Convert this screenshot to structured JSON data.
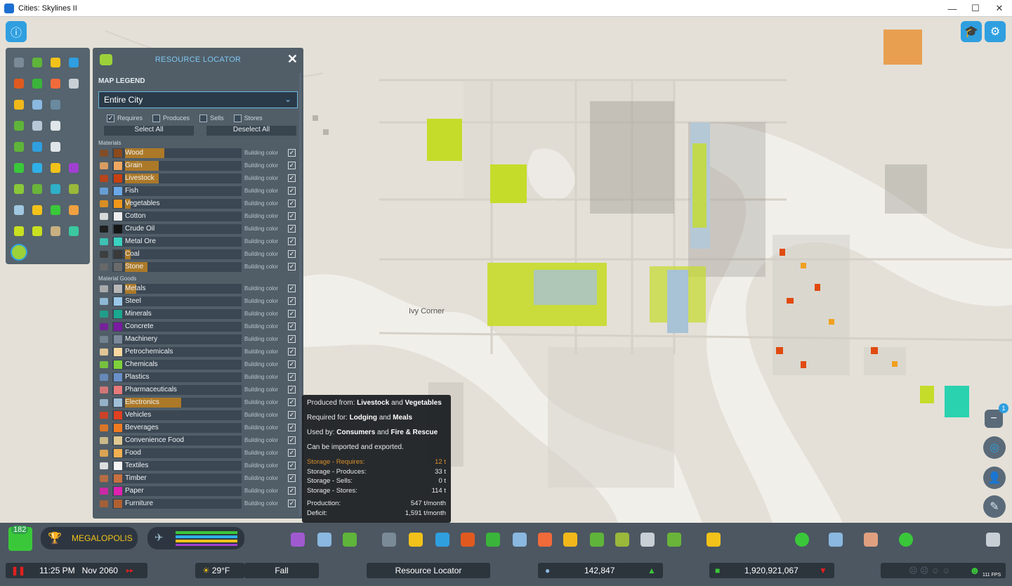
{
  "window": {
    "title": "Cities: Skylines II",
    "minimize": "—",
    "maximize": "☐",
    "close": "✕"
  },
  "map": {
    "district_label": "Ivy Corner"
  },
  "panel": {
    "title": "RESOURCE LOCATOR",
    "close": "✕",
    "legend_label": "MAP LEGEND",
    "scope": "Entire City",
    "filters": [
      {
        "label": "Requires",
        "checked": true
      },
      {
        "label": "Produces",
        "checked": false
      },
      {
        "label": "Sells",
        "checked": false
      },
      {
        "label": "Stores",
        "checked": false
      }
    ],
    "select_all": "Select All",
    "deselect_all": "Deselect All",
    "materials_label": "Materials",
    "materials": [
      {
        "name": "Wood",
        "color": "#8b4a1c",
        "mode": "Building color",
        "hl": 0.35
      },
      {
        "name": "Grain",
        "color": "#f0a860",
        "mode": "Building color",
        "hl": 0.3
      },
      {
        "name": "Livestock",
        "color": "#c9400f",
        "mode": "Building color",
        "hl": 0.3
      },
      {
        "name": "Fish",
        "color": "#6aa8e8",
        "mode": "Building color",
        "hl": 0
      },
      {
        "name": "Vegetables",
        "color": "#f0961a",
        "mode": "Building color",
        "hl": 0.05
      },
      {
        "name": "Cotton",
        "color": "#eeeeee",
        "mode": "Building color",
        "hl": 0
      },
      {
        "name": "Crude Oil",
        "color": "#151515",
        "mode": "Building color",
        "hl": 0
      },
      {
        "name": "Metal Ore",
        "color": "#3ad2c0",
        "mode": "Building color",
        "hl": 0
      },
      {
        "name": "Coal",
        "color": "#3a3a3a",
        "mode": "Building color",
        "hl": 0.05
      },
      {
        "name": "Stone",
        "color": "#6a6a6a",
        "mode": "Building color",
        "hl": 0.2
      }
    ],
    "goods_label": "Material Goods",
    "goods": [
      {
        "name": "Metals",
        "color": "#b7b7b7",
        "mode": "Building color",
        "hl": 0.1
      },
      {
        "name": "Steel",
        "color": "#9ac8e8",
        "mode": "Building color",
        "hl": 0
      },
      {
        "name": "Minerals",
        "color": "#1aa890",
        "mode": "Building color",
        "hl": 0
      },
      {
        "name": "Concrete",
        "color": "#7a1aa0",
        "mode": "Building color",
        "hl": 0
      },
      {
        "name": "Machinery",
        "color": "#7a8a9a",
        "mode": "Building color",
        "hl": 0
      },
      {
        "name": "Petrochemicals",
        "color": "#f8d7a0",
        "mode": "Building color",
        "hl": 0
      },
      {
        "name": "Chemicals",
        "color": "#7ed23a",
        "mode": "Building color",
        "hl": 0
      },
      {
        "name": "Plastics",
        "color": "#6a90c8",
        "mode": "Building color",
        "hl": 0
      },
      {
        "name": "Pharmaceuticals",
        "color": "#e87a7a",
        "mode": "Building color",
        "hl": 0
      },
      {
        "name": "Electronics",
        "color": "#a0c0d8",
        "mode": "Building color",
        "hl": 0.5
      },
      {
        "name": "Vehicles",
        "color": "#e04020",
        "mode": "Building color",
        "hl": 0
      },
      {
        "name": "Beverages",
        "color": "#f07a20",
        "mode": "Building color",
        "hl": 0
      },
      {
        "name": "Convenience Food",
        "color": "#e0c890",
        "mode": "Building color",
        "hl": 0
      },
      {
        "name": "Food",
        "color": "#f2b050",
        "mode": "Building color",
        "hl": 0
      },
      {
        "name": "Textiles",
        "color": "#f5f5f5",
        "mode": "Building color",
        "hl": 0
      },
      {
        "name": "Timber",
        "color": "#c87040",
        "mode": "Building color",
        "hl": 0
      },
      {
        "name": "Paper",
        "color": "#e020b0",
        "mode": "Building color",
        "hl": 0
      },
      {
        "name": "Furniture",
        "color": "#b06030",
        "mode": "Building color",
        "hl": 0
      }
    ]
  },
  "tooltip": {
    "produced_prefix": "Produced from:",
    "produced_a": "Livestock",
    "produced_and": "and",
    "produced_b": "Vegetables",
    "required_prefix": "Required for:",
    "required_a": "Lodging",
    "required_and": "and",
    "required_b": "Meals",
    "used_prefix": "Used by:",
    "used_a": "Consumers",
    "used_and": "and",
    "used_b": "Fire & Rescue",
    "trade": "Can be imported and exported.",
    "storage": [
      {
        "label": "Storage - Requires:",
        "value": "12 t"
      },
      {
        "label": "Storage - Produces:",
        "value": "33 t"
      },
      {
        "label": "Storage - Sells:",
        "value": "0 t"
      },
      {
        "label": "Storage - Stores:",
        "value": "114 t"
      }
    ],
    "production_label": "Production:",
    "production_value": "547 t/month",
    "deficit_label": "Deficit:",
    "deficit_value": "1,591 t/month"
  },
  "bottom": {
    "level_badge": "182",
    "milestone": "MEGALOPOLIS",
    "time": "11:25 PM",
    "date": "Nov 2060",
    "temperature": "29°F",
    "season": "Fall",
    "active_tool": "Resource Locator",
    "population": "142,847",
    "money": "1,920,921,067",
    "fps": "111 FPS",
    "zoom_badge": "1"
  },
  "colors": {
    "accent": "#2f9fe0",
    "highlight": "#d38a1a",
    "lime": "#c8e020"
  }
}
